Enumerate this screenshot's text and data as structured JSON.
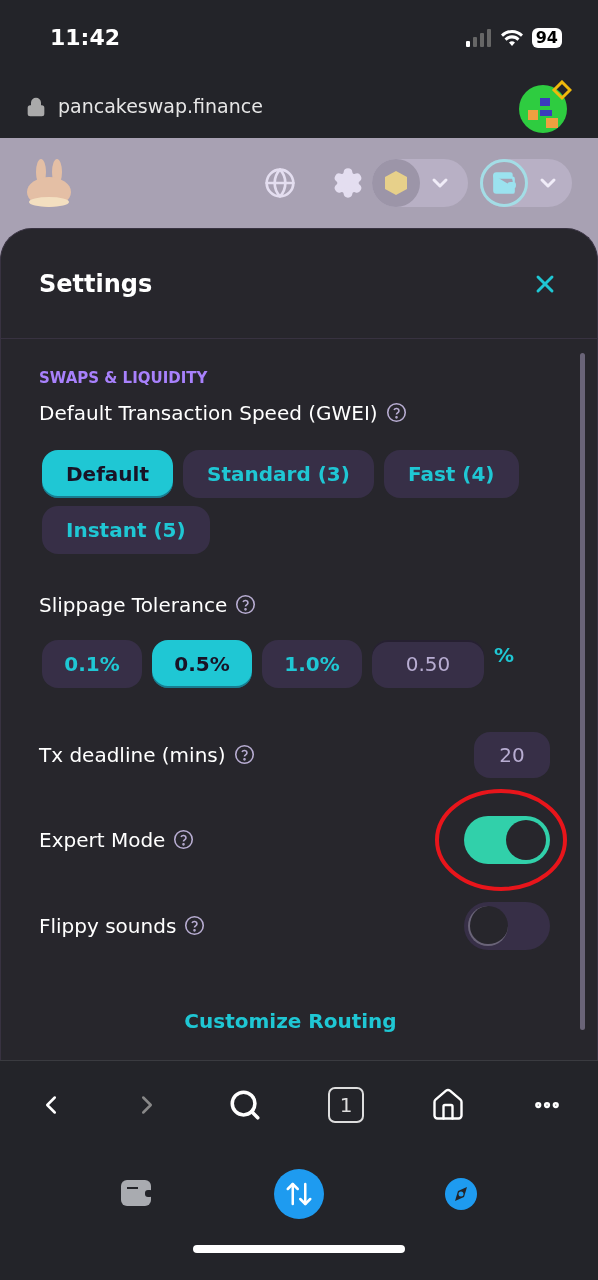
{
  "status_bar": {
    "time": "11:42",
    "battery": "94"
  },
  "address_bar": {
    "url": "pancakeswap.finance"
  },
  "settings": {
    "title": "Settings",
    "section": "SWAPS & LIQUIDITY",
    "gas": {
      "label": "Default Transaction Speed (GWEI)",
      "options": [
        {
          "label": "Default",
          "selected": true
        },
        {
          "label": "Standard (3)",
          "selected": false
        },
        {
          "label": "Fast (4)",
          "selected": false
        },
        {
          "label": "Instant (5)",
          "selected": false
        }
      ]
    },
    "slippage": {
      "label": "Slippage Tolerance",
      "options": [
        {
          "label": "0.1%",
          "selected": false
        },
        {
          "label": "0.5%",
          "selected": true
        },
        {
          "label": "1.0%",
          "selected": false
        }
      ],
      "custom_value": "0.50",
      "unit": "%"
    },
    "deadline": {
      "label": "Tx deadline (mins)",
      "value": "20"
    },
    "toggles": [
      {
        "label": "Expert Mode",
        "on": true,
        "highlighted": true
      },
      {
        "label": "Flippy sounds",
        "on": false,
        "highlighted": false
      }
    ],
    "link": "Customize Routing"
  },
  "browser_toolbar": {
    "tab_count": "1"
  }
}
